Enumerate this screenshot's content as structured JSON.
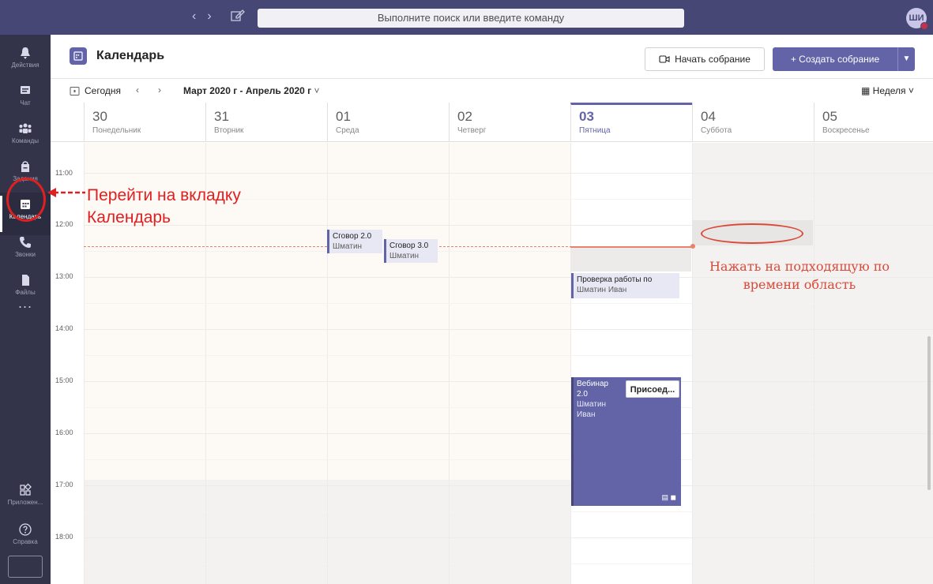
{
  "topbar": {
    "search_placeholder": "Выполните поиск или введите команду",
    "avatar_initials": "ШИ"
  },
  "rail": {
    "items": [
      {
        "label": "Действия",
        "icon": "bell-icon"
      },
      {
        "label": "Чат",
        "icon": "chat-icon"
      },
      {
        "label": "Команды",
        "icon": "teams-icon"
      },
      {
        "label": "Задания",
        "icon": "assignments-icon"
      },
      {
        "label": "Календарь",
        "icon": "calendar-icon"
      },
      {
        "label": "Звонки",
        "icon": "phone-icon"
      },
      {
        "label": "Файлы",
        "icon": "files-icon"
      },
      {
        "label": "Приложен...",
        "icon": "apps-icon"
      },
      {
        "label": "Справка",
        "icon": "help-icon"
      }
    ],
    "more_label": "..."
  },
  "header": {
    "title": "Календарь",
    "start_meeting_label": "Начать собрание",
    "create_meeting_label": "Создать собрание"
  },
  "toolbar": {
    "today_label": "Сегодня",
    "range_label": "Март 2020 г - Апрель 2020 г",
    "view_label": "Неделя"
  },
  "days": [
    {
      "num": "30",
      "name": "Понедельник"
    },
    {
      "num": "31",
      "name": "Вторник"
    },
    {
      "num": "01",
      "name": "Среда"
    },
    {
      "num": "02",
      "name": "Четверг"
    },
    {
      "num": "03",
      "name": "Пятница"
    },
    {
      "num": "04",
      "name": "Суббота"
    },
    {
      "num": "05",
      "name": "Воскресенье"
    }
  ],
  "times": [
    "11:00",
    "12:00",
    "13:00",
    "14:00",
    "15:00",
    "16:00",
    "17:00",
    "18:00"
  ],
  "events": [
    {
      "title": "Сговор 2.0",
      "organizer": "Шматин"
    },
    {
      "title": "Сговор 3.0",
      "organizer": "Шматин"
    },
    {
      "title": "Проверка работы по",
      "organizer": "Шматин Иван"
    },
    {
      "title": "Вебинар 2.0",
      "organizer": "Шматин Иван",
      "join_label": "Присоед..."
    }
  ],
  "annotations": {
    "calendar_hint": "Перейти на вкладку Календарь",
    "slot_hint": "Нажать на подходящую по времени область"
  },
  "colors": {
    "brand": "#6264a7",
    "annotation": "#e02020",
    "now_line": "#e8826a"
  }
}
